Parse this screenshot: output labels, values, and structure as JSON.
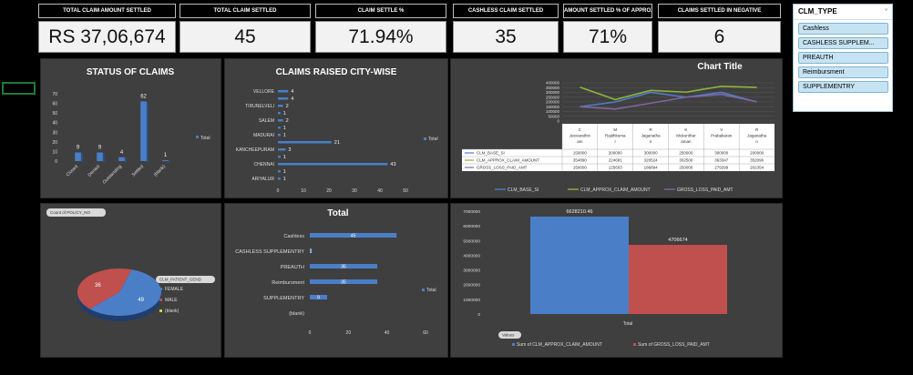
{
  "kpis": [
    {
      "label": "TOTAL CLAIM AMOUNT  SETTLED",
      "value": "RS 37,06,674"
    },
    {
      "label": "TOTAL CLAIM SETTLED",
      "value": "45"
    },
    {
      "label": "CLAIM SETTLE %",
      "value": "71.94%"
    },
    {
      "label": "CASHLESS CLAIM SETTLED",
      "value": "35"
    },
    {
      "label": "AMOUNT SETTLED % OF APPROX",
      "value": "71%"
    },
    {
      "label": "CLAIMS SETTLED IN NEGATIVE",
      "value": "6"
    }
  ],
  "slicer": {
    "title": "CLM_TYPE",
    "items": [
      "Cashless",
      "CASHLESS SUPPLEM...",
      "PREAUTH",
      "Reimbursment",
      "SUPPLEMENTRY"
    ]
  },
  "colors": {
    "blue": "#4a7fc8",
    "red": "#c0504d",
    "green": "#8fb33a",
    "purple": "#8064a2",
    "panel": "#3f3f3f"
  },
  "chart_data": [
    {
      "type": "bar",
      "title": "STATUS OF CLAIMS",
      "categories": [
        "Closed",
        "Denied",
        "Outstanding",
        "Settled",
        "(blank)"
      ],
      "series": [
        {
          "name": "Total",
          "values": [
            9,
            9,
            4,
            62,
            1
          ]
        }
      ],
      "ylim": [
        0,
        70
      ],
      "yticks": [
        0,
        10,
        20,
        30,
        40,
        50,
        60,
        70
      ],
      "legend": "right"
    },
    {
      "type": "bar",
      "orientation": "horizontal",
      "title": "CLAIMS RAISED CITY-WISE",
      "categories": [
        "VELLORE",
        "",
        "TIRUNELVELI",
        "",
        "SALEM",
        "",
        "MADURAI",
        "",
        "KANCHEEPURAM",
        "",
        "CHENNAI",
        "",
        "ARIYALUR"
      ],
      "series": [
        {
          "name": "Total",
          "values": [
            4,
            4,
            2,
            1,
            2,
            1,
            1,
            21,
            3,
            1,
            43,
            1,
            1
          ]
        }
      ],
      "xlim": [
        0,
        50
      ],
      "xticks": [
        0,
        10,
        20,
        30,
        40,
        50
      ],
      "legend": "right"
    },
    {
      "type": "line",
      "title": "Chart Title",
      "categories": [
        "C Jeevarathinam",
        "M Rajithkumar",
        "R Jaganathan",
        "K Mukunthar aman",
        "V Prabakaran",
        "R Jaganathan"
      ],
      "category_lines": [
        [
          "C",
          "Jeevarathin",
          "am"
        ],
        [
          "M",
          "Rajithkuma",
          "r"
        ],
        [
          "R",
          "Jaganatha",
          "n"
        ],
        [
          "K",
          "Mukunthar",
          "aman"
        ],
        [
          "V",
          "Prabakaran"
        ],
        [
          "R",
          "Jaganatha",
          "n"
        ]
      ],
      "series": [
        {
          "name": "CLM_BASE_SI",
          "values": [
            150000,
            200000,
            300000,
            250000,
            300000,
            200000
          ]
        },
        {
          "name": "CLM_APPROX_CLAIM_AMOUNT",
          "values": [
            354890,
            224681,
            320524,
            302500,
            363347,
            352090
          ]
        },
        {
          "name": "GROSS_LOSS_PAID_AMT",
          "values": [
            150000,
            125603,
            186894,
            250000,
            279299,
            202354
          ]
        }
      ],
      "ylim": [
        0,
        400000
      ],
      "yticks": [
        "0",
        "50000",
        "100000",
        "150000",
        "200000",
        "250000",
        "300000",
        "350000",
        "400000"
      ],
      "table_rows": [
        [
          "150000",
          "200000",
          "300000",
          "250000",
          "300000",
          "200000"
        ],
        [
          "354890",
          "224681",
          "320524",
          "302500",
          "363347",
          "352090"
        ],
        [
          "150000",
          "125603",
          "186894",
          "250000",
          "279299",
          "202354"
        ]
      ],
      "legend": "bottom"
    },
    {
      "type": "pie",
      "pill": "Count of POLICY_NO",
      "legend_title": "CLM_PATIENT_GEND",
      "slices": [
        {
          "name": "FEMALE",
          "value": 49
        },
        {
          "name": "MALE",
          "value": 36
        },
        {
          "name": "(blank)",
          "value": 0
        }
      ],
      "legend": "right"
    },
    {
      "type": "bar",
      "orientation": "horizontal",
      "title": "Total",
      "categories": [
        "Cashless",
        "CASHLESS SUPPLEMENTRY",
        "PREAUTH",
        "Reimbursment",
        "SUPPLEMENTRY",
        "(blank)"
      ],
      "series": [
        {
          "name": "Total",
          "values": [
            45,
            1,
            35,
            35,
            9,
            0
          ]
        }
      ],
      "labels": [
        "45",
        "1",
        "35",
        "35",
        "9",
        ""
      ],
      "xlim": [
        0,
        60
      ],
      "xticks": [
        0,
        20,
        40,
        60
      ],
      "legend": "right"
    },
    {
      "type": "bar",
      "categories": [
        "Total"
      ],
      "series": [
        {
          "name": "Sum of CLM_APPROX_CLAIM_AMOUNT",
          "values": [
            6628210.46
          ]
        },
        {
          "name": "Sum of GROSS_LOSS_PAID_AMT",
          "values": [
            4706674
          ]
        }
      ],
      "labels": [
        "6628210.46",
        "4706674"
      ],
      "ylim": [
        0,
        7000000
      ],
      "yticks": [
        "0",
        "1000000",
        "2000000",
        "3000000",
        "4000000",
        "5000000",
        "6000000",
        "7000000"
      ],
      "pill": "Values",
      "legend": "bottom"
    }
  ]
}
